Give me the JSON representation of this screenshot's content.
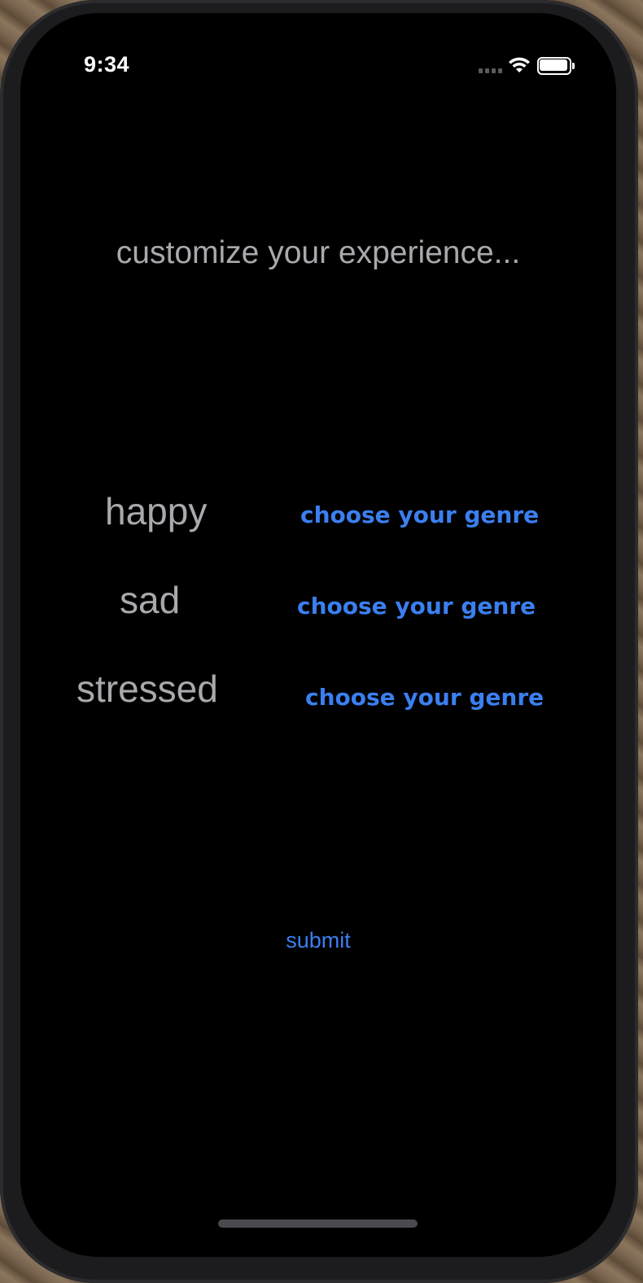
{
  "status_bar": {
    "time": "9:34",
    "icons": [
      "cellular-signal-icon",
      "wifi-icon",
      "battery-icon"
    ]
  },
  "main": {
    "title": "customize your experience...",
    "moods": [
      {
        "label": "happy",
        "genre_button": "choose your genre"
      },
      {
        "label": "sad",
        "genre_button": "choose your genre"
      },
      {
        "label": "stressed",
        "genre_button": "choose your genre"
      }
    ],
    "submit_label": "submit"
  },
  "colors": {
    "background": "#000000",
    "text_secondary": "#a9a9ad",
    "accent": "#3b7ff0"
  }
}
